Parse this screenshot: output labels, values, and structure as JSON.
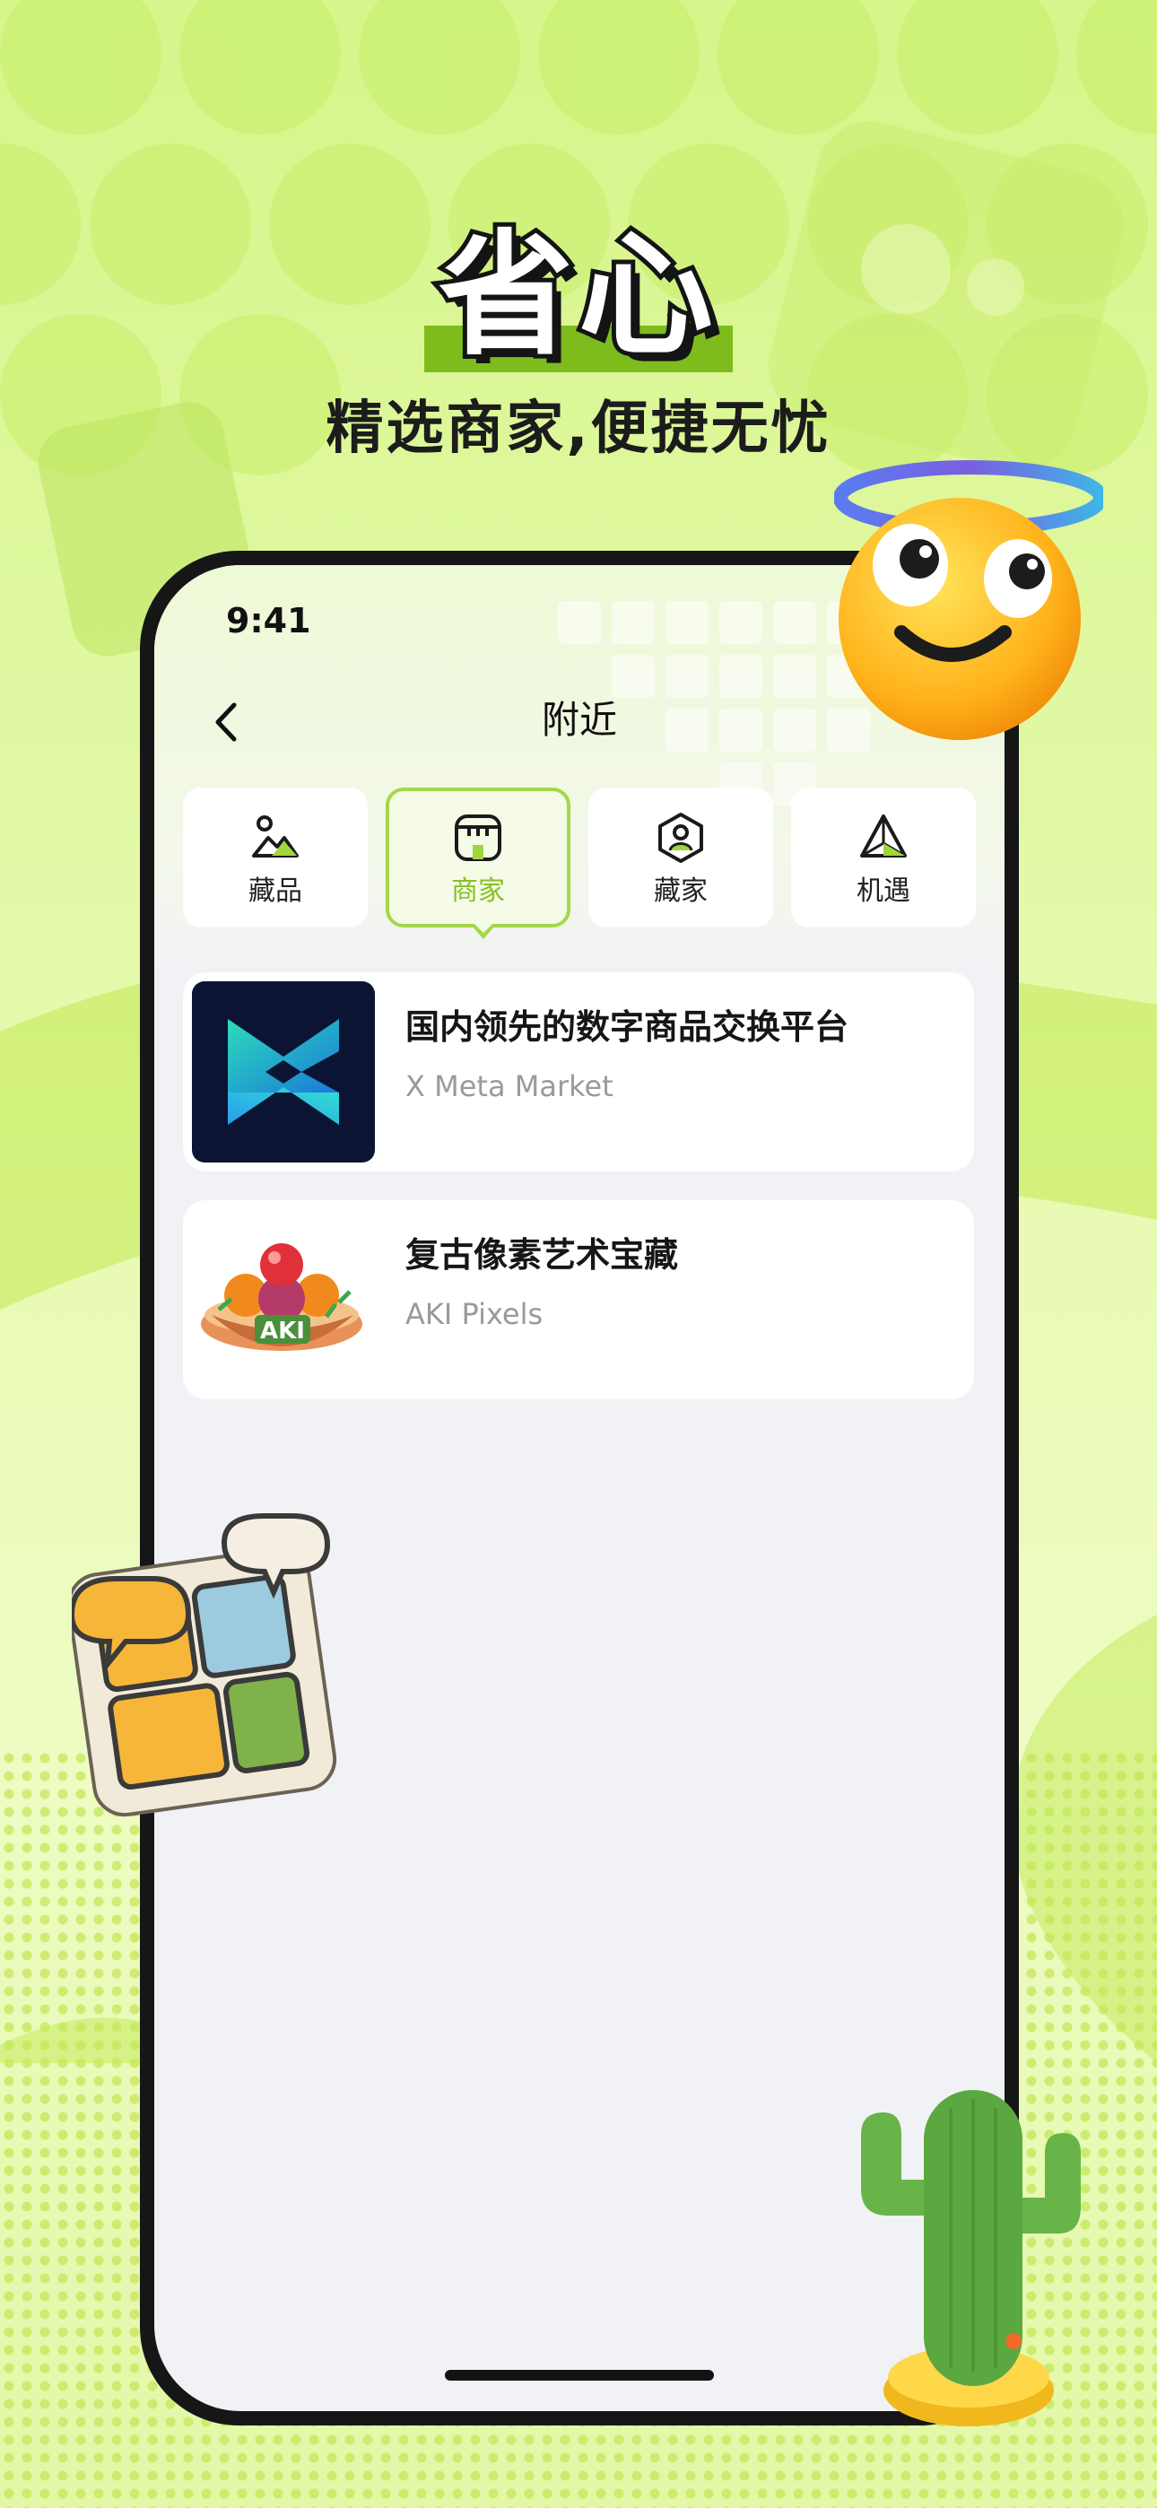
{
  "headline": "省心",
  "subtitle": "精选商家,便捷无忧",
  "status_bar": {
    "time": "9:41"
  },
  "nav": {
    "title": "附近"
  },
  "tabs": [
    {
      "label": "藏品",
      "icon": "image-icon",
      "active": false
    },
    {
      "label": "商家",
      "icon": "store-icon",
      "active": true
    },
    {
      "label": "藏家",
      "icon": "collector-icon",
      "active": false
    },
    {
      "label": "机遇",
      "icon": "opportunity-icon",
      "active": false
    }
  ],
  "merchants": [
    {
      "title": "国内领先的数字商品交换平台",
      "subtitle": "X  Meta Market",
      "logo": "x-meta-logo"
    },
    {
      "title": "复古像素艺术宝藏",
      "subtitle": "AKI Pixels",
      "logo": "aki-pixels-logo",
      "logo_text": "AKI"
    }
  ],
  "colors": {
    "accent": "#86c025",
    "background": "#d6f58a",
    "phone_frame": "#161616"
  }
}
